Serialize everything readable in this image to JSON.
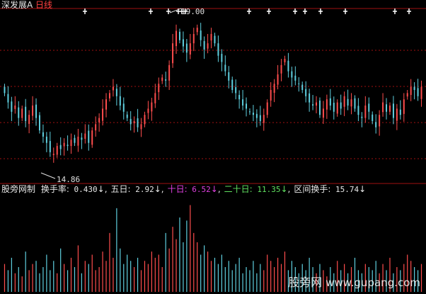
{
  "header": {
    "stock_name": "深发展A",
    "period": "日线"
  },
  "indicator": {
    "name": "股旁网制",
    "items": [
      {
        "label": "换手率:",
        "value": "0.430",
        "arrow": "↓",
        "color": "#e8e8e8"
      },
      {
        "label": "五日:",
        "value": "2.92",
        "arrow": "↓",
        "color": "#e8e8e8"
      },
      {
        "label": "十日:",
        "value": "6.52",
        "arrow": "↓",
        "color": "#e040e0"
      },
      {
        "label": "二十日:",
        "value": "11.35",
        "arrow": "↓",
        "color": "#60e060"
      },
      {
        "label": "区间换手:",
        "value": "15.74",
        "arrow": "↓",
        "color": "#e8e8e8"
      }
    ]
  },
  "watermark": {
    "text": "股旁网",
    "domain": "www.gupang.com"
  },
  "colors": {
    "up": "#ff4d4d",
    "down": "#5fd0e0",
    "grid": "#a01010",
    "marker": "#ffffff",
    "signal": "#ffffff"
  },
  "chart_data": [
    {
      "type": "candlestick",
      "title": "深发展A 日线",
      "high_label": "19.00",
      "low_label": "14.86",
      "ylim": [
        14.2,
        19.55
      ],
      "count": 120,
      "closes": [
        16.9,
        16.6,
        16.3,
        16.5,
        16.1,
        16.4,
        16.0,
        16.2,
        16.5,
        16.1,
        15.7,
        15.5,
        15.3,
        15.0,
        14.95,
        15.2,
        15.1,
        15.3,
        15.2,
        15.4,
        15.3,
        15.5,
        15.4,
        15.6,
        15.3,
        15.7,
        15.9,
        16.1,
        16.4,
        16.7,
        16.9,
        17.1,
        16.8,
        16.5,
        16.3,
        16.1,
        15.9,
        16.0,
        15.8,
        15.9,
        16.2,
        16.4,
        16.6,
        16.9,
        17.2,
        17.4,
        17.3,
        17.8,
        18.5,
        18.9,
        18.6,
        18.4,
        18.2,
        18.5,
        18.8,
        19.0,
        18.6,
        18.3,
        18.5,
        18.8,
        18.5,
        18.1,
        17.9,
        17.6,
        17.3,
        17.0,
        16.9,
        16.7,
        16.5,
        16.4,
        16.3,
        16.2,
        16.1,
        16.0,
        16.2,
        16.6,
        17.0,
        17.2,
        17.5,
        17.8,
        18.0,
        17.6,
        17.4,
        17.3,
        17.2,
        17.0,
        16.8,
        16.6,
        16.5,
        16.6,
        16.2,
        16.4,
        16.7,
        16.5,
        16.3,
        16.6,
        16.4,
        16.8,
        16.5,
        16.7,
        16.4,
        16.2,
        16.1,
        16.5,
        16.3,
        16.0,
        15.8,
        16.2,
        16.6,
        16.3,
        16.5,
        16.1,
        16.4,
        16.2,
        16.7,
        16.9,
        17.1,
        17.0,
        16.8,
        17.1
      ],
      "signal_markers_at": [
        20,
        57,
        58,
        59,
        60,
        61,
        62,
        63,
        91,
        99,
        107,
        113,
        117,
        127,
        137,
        147,
        153,
        165,
        179,
        194,
        212
      ],
      "marker_cols": [
        12,
        52,
        57,
        61,
        63,
        65,
        86,
        93,
        101,
        106,
        111,
        121,
        136,
        142
      ]
    },
    {
      "type": "bar",
      "title": "换手率",
      "ylim": [
        0,
        3.2
      ],
      "values": [
        0.9,
        0.7,
        1.1,
        0.6,
        0.8,
        0.5,
        1.3,
        0.7,
        0.9,
        1.0,
        0.6,
        0.8,
        1.2,
        0.7,
        1.0,
        0.6,
        1.4,
        0.9,
        0.7,
        1.1,
        0.8,
        1.5,
        0.6,
        1.0,
        0.9,
        1.2,
        0.7,
        0.8,
        1.3,
        1.0,
        1.9,
        1.1,
        2.7,
        1.4,
        0.9,
        1.2,
        1.0,
        0.8,
        1.1,
        0.7,
        1.0,
        0.9,
        1.3,
        1.1,
        1.2,
        0.8,
        1.9,
        1.4,
        2.1,
        1.7,
        2.4,
        1.6,
        2.3,
        2.8,
        1.9,
        1.6,
        1.2,
        1.5,
        1.3,
        1.0,
        1.1,
        0.9,
        1.2,
        0.8,
        1.0,
        0.7,
        0.9,
        1.1,
        0.6,
        0.8,
        0.7,
        1.0,
        0.6,
        0.9,
        0.7,
        1.2,
        1.0,
        0.8,
        1.1,
        0.9,
        1.3,
        0.7,
        1.0,
        0.8,
        0.6,
        0.9,
        0.7,
        1.1,
        0.8,
        0.6,
        0.9,
        0.7,
        0.5,
        0.8,
        0.6,
        1.0,
        0.7,
        0.9,
        0.6,
        0.8,
        1.1,
        0.7,
        0.6,
        0.9,
        0.8,
        0.7,
        1.0,
        0.6,
        0.9,
        0.7,
        1.1,
        0.6,
        0.8,
        0.7,
        0.9,
        1.2,
        1.0,
        0.8,
        0.7,
        0.9
      ]
    }
  ]
}
